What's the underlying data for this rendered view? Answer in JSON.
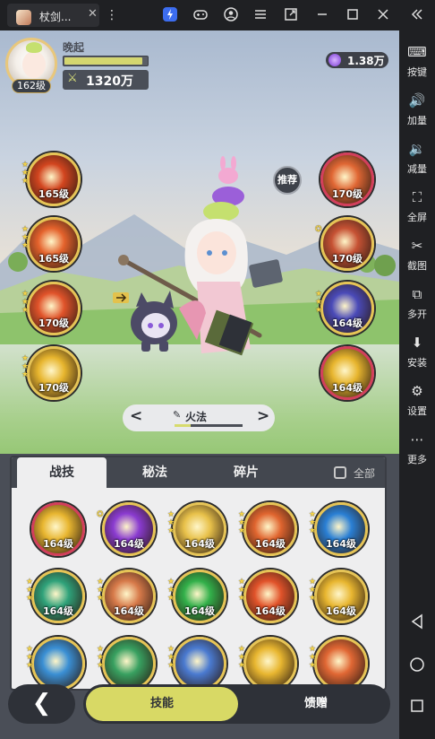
{
  "emulator": {
    "tab_title": "杖剑...",
    "tab_close": "✕",
    "menu_dots": "⋮",
    "toolbar_icons": [
      "bolt-icon",
      "gamepad-icon",
      "user-icon",
      "hamburger-icon",
      "window-share-icon",
      "minimize-icon",
      "maximize-icon",
      "close-icon",
      "collapse-icon"
    ],
    "sidebar": [
      {
        "label": "按键",
        "icon": "keyboard-icon",
        "glyph": "⌨"
      },
      {
        "label": "加量",
        "icon": "volume-up-icon",
        "glyph": "🔊"
      },
      {
        "label": "减量",
        "icon": "volume-down-icon",
        "glyph": "🔉"
      },
      {
        "label": "全屏",
        "icon": "fullscreen-icon",
        "glyph": "⛶"
      },
      {
        "label": "截图",
        "icon": "scissors-icon",
        "glyph": "✂"
      },
      {
        "label": "多开",
        "icon": "multi-instance-icon",
        "glyph": "⧉"
      },
      {
        "label": "安装",
        "icon": "apk-install-icon",
        "glyph": "⬇"
      },
      {
        "label": "设置",
        "icon": "settings-icon",
        "glyph": "⚙"
      },
      {
        "label": "更多",
        "icon": "more-icon",
        "glyph": "⋯"
      }
    ]
  },
  "player": {
    "name": "晚起",
    "level": "162级",
    "exp_ratio": 0.95,
    "power": "1320万",
    "currency": "1.38万"
  },
  "equipped_left": [
    {
      "level": "165级",
      "stars": 3,
      "color": "#d2451f",
      "frame": "gold"
    },
    {
      "level": "165级",
      "stars": 3,
      "color": "#e4622c",
      "frame": "gold"
    },
    {
      "level": "170级",
      "stars": 3,
      "color": "#e0532a",
      "frame": "gold"
    },
    {
      "level": "170级",
      "stars": 3,
      "color": "#e7b52e",
      "frame": "gold"
    }
  ],
  "equipped_right": [
    {
      "level": "170级",
      "stars": 0,
      "color": "#e06734",
      "frame": "red"
    },
    {
      "level": "170级",
      "stars": 5,
      "color": "#c65234",
      "frame": "gold"
    },
    {
      "level": "164级",
      "stars": 3,
      "color": "#4a4ab8",
      "frame": "gold"
    },
    {
      "level": "164级",
      "stars": 0,
      "color": "#e7b52e",
      "frame": "red"
    }
  ],
  "recommend_label": "推荐",
  "school": {
    "name": "火法",
    "prev": "<",
    "next": ">"
  },
  "panel": {
    "tabs": [
      "战技",
      "秘法",
      "碎片"
    ],
    "active_tab": 0,
    "filter_label": "全部",
    "skills": [
      {
        "level": "164级",
        "stars": 0,
        "color": "#e8b630",
        "frame": "red"
      },
      {
        "level": "164级",
        "stars": 5,
        "color": "#8a3bd0",
        "frame": "gold"
      },
      {
        "level": "164级",
        "stars": 3,
        "color": "#e8c14a",
        "frame": "gold"
      },
      {
        "level": "164级",
        "stars": 3,
        "color": "#e0652f",
        "frame": "gold"
      },
      {
        "level": "164级",
        "stars": 3,
        "color": "#2a7fd4",
        "frame": "gold"
      },
      {
        "level": "164级",
        "stars": 3,
        "color": "#2fa27a",
        "frame": "gold"
      },
      {
        "level": "164级",
        "stars": 3,
        "color": "#d77a4a",
        "frame": "gold"
      },
      {
        "level": "164级",
        "stars": 3,
        "color": "#32b04a",
        "frame": "gold"
      },
      {
        "level": "164级",
        "stars": 3,
        "color": "#e1532a",
        "frame": "gold"
      },
      {
        "level": "164级",
        "stars": 3,
        "color": "#e8b630",
        "frame": "gold"
      },
      {
        "level": "",
        "stars": 3,
        "color": "#3a8fd4",
        "frame": "gold"
      },
      {
        "level": "",
        "stars": 3,
        "color": "#38a060",
        "frame": "gold"
      },
      {
        "level": "",
        "stars": 3,
        "color": "#4a7ad0",
        "frame": "gold"
      },
      {
        "level": "",
        "stars": 3,
        "color": "#e8b630",
        "frame": "gold"
      },
      {
        "level": "",
        "stars": 3,
        "color": "#e06734",
        "frame": "gold"
      }
    ]
  },
  "bottom_nav": {
    "back": "❮",
    "skill_label": "技能",
    "gift_label": "馈赠"
  }
}
